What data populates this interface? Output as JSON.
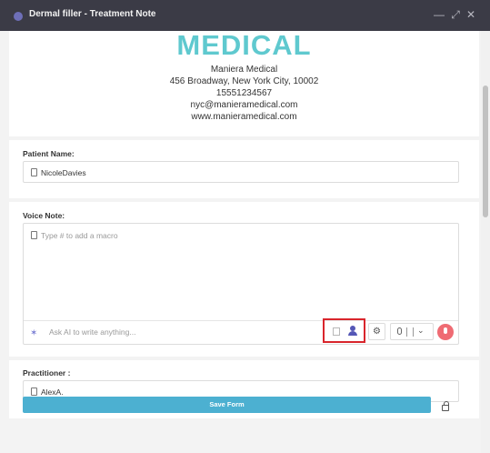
{
  "window": {
    "title": "Dermal filler - Treatment Note",
    "minimize_icon": "minimize-icon",
    "expand_icon": "expand-icon",
    "close_icon": "close-icon"
  },
  "header": {
    "logo_text": "MEDICAL",
    "lines": [
      "Maniera Medical",
      "456 Broadway, New York City, 10002",
      "15551234567",
      "nyc@manieramedical.com",
      "www.manieramedical.com"
    ]
  },
  "patient": {
    "label": "Patient Name:",
    "value": "NicoleDavies"
  },
  "voice_note": {
    "label": "Voice Note:",
    "placeholder": "Type # to add a macro",
    "ai_placeholder": "Ask AI to write anything..."
  },
  "practitioner": {
    "label": "Practitioner :",
    "value": "AlexA."
  },
  "footer": {
    "save_label": "Save Form"
  },
  "colors": {
    "brand": "#5fc9cf",
    "save": "#4cb0d1",
    "highlight": "#d9252c",
    "mic": "#ef6b73"
  }
}
